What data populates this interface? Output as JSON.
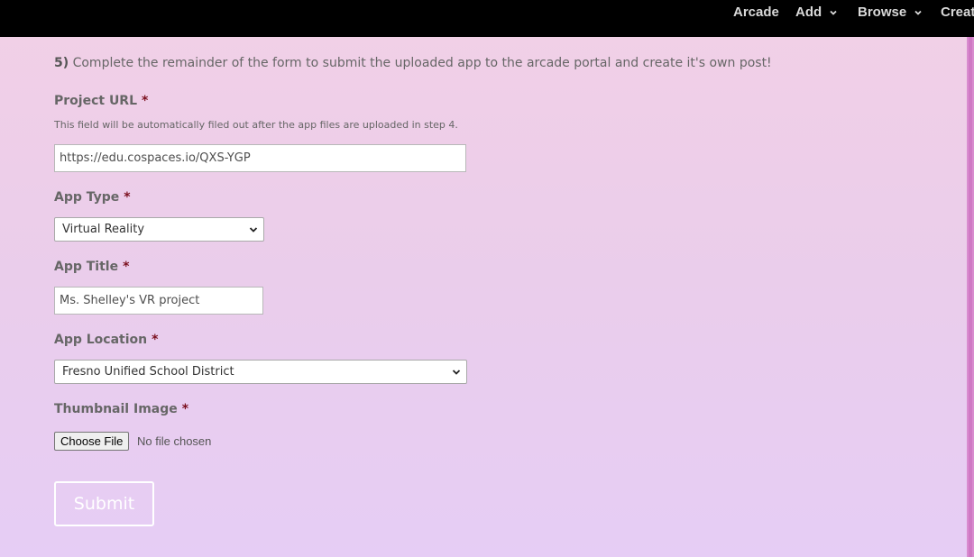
{
  "nav": {
    "items": [
      {
        "label": "Arcade",
        "has_dropdown": false
      },
      {
        "label": "Add",
        "has_dropdown": true
      },
      {
        "label": "Browse",
        "has_dropdown": true
      },
      {
        "label": "Creat",
        "has_dropdown": false
      }
    ]
  },
  "form": {
    "step_number": "5)",
    "step_text": "Complete the remainder of the form to submit the uploaded app to the arcade portal and create it's own post!",
    "required_marker": "*",
    "project_url": {
      "label": "Project URL",
      "description": "This field will be automatically filed out after the app files are uploaded in step 4.",
      "value": "https://edu.cospaces.io/QXS-YGP"
    },
    "app_type": {
      "label": "App Type",
      "selected": "Virtual Reality"
    },
    "app_title": {
      "label": "App Title",
      "value": "Ms. Shelley's VR project"
    },
    "app_location": {
      "label": "App Location",
      "selected": "Fresno Unified School District"
    },
    "thumbnail": {
      "label": "Thumbnail Image",
      "button_label": "Choose File",
      "status": "No file chosen"
    },
    "submit_label": "Submit"
  },
  "colors": {
    "topbar": "#000000",
    "required": "#7a0f1e",
    "background_top": "#f2d0e6",
    "background_bottom": "#e6cdf5"
  },
  "icons": {
    "dropdown": "chevron-down-icon"
  }
}
